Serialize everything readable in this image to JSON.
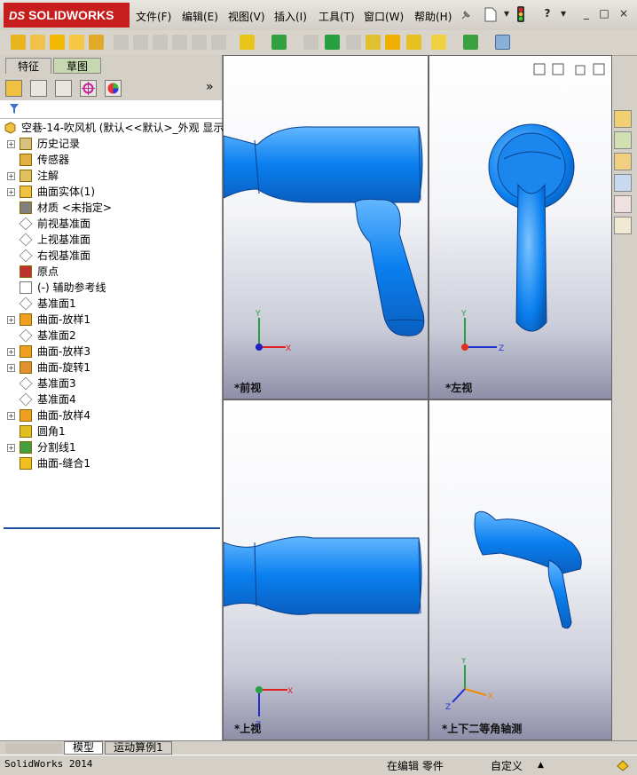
{
  "app": {
    "brand": "SOLIDWORKS",
    "brand_prefix": "DS"
  },
  "menus": [
    "文件(F)",
    "编辑(E)",
    "视图(V)",
    "插入(I)",
    "工具(T)",
    "窗口(W)",
    "帮助(H)"
  ],
  "window_controls": {
    "help": "?",
    "minimize": "_",
    "restore": "□",
    "close": "×"
  },
  "panel_tabs": [
    "特征",
    "草图"
  ],
  "panel_expand": "»",
  "tree": {
    "root": "空巷-14-吹风机   (默认<<默认>_外观 显示",
    "items": [
      {
        "label": "历史记录",
        "icon": "history-icon",
        "expandable": true
      },
      {
        "label": "传感器",
        "icon": "sensor-icon",
        "expandable": false
      },
      {
        "label": "注解",
        "icon": "annotation-icon",
        "expandable": true
      },
      {
        "label": "曲面实体(1)",
        "icon": "surface-body-icon",
        "expandable": true
      },
      {
        "label": "材质 <未指定>",
        "icon": "material-icon",
        "expandable": false
      },
      {
        "label": "前视基准面",
        "icon": "plane-icon",
        "expandable": false
      },
      {
        "label": "上视基准面",
        "icon": "plane-icon",
        "expandable": false
      },
      {
        "label": "右视基准面",
        "icon": "plane-icon",
        "expandable": false
      },
      {
        "label": "原点",
        "icon": "origin-icon",
        "expandable": false
      },
      {
        "label": "(-) 辅助参考线",
        "icon": "sketch-icon",
        "expandable": false
      },
      {
        "label": "基准面1",
        "icon": "plane-icon",
        "expandable": false
      },
      {
        "label": "曲面-放样1",
        "icon": "loft-icon",
        "expandable": true
      },
      {
        "label": "基准面2",
        "icon": "plane-icon",
        "expandable": false
      },
      {
        "label": "曲面-放样3",
        "icon": "loft-icon",
        "expandable": true
      },
      {
        "label": "曲面-旋转1",
        "icon": "revolve-icon",
        "expandable": true
      },
      {
        "label": "基准面3",
        "icon": "plane-icon",
        "expandable": false
      },
      {
        "label": "基准面4",
        "icon": "plane-icon",
        "expandable": false
      },
      {
        "label": "曲面-放样4",
        "icon": "loft-icon",
        "expandable": true
      },
      {
        "label": "圆角1",
        "icon": "fillet-icon",
        "expandable": false
      },
      {
        "label": "分割线1",
        "icon": "split-line-icon",
        "expandable": true
      },
      {
        "label": "曲面-缝合1",
        "icon": "knit-icon",
        "expandable": false
      }
    ]
  },
  "viewports": {
    "front": "*前视",
    "left": "*左视",
    "top": "*上视",
    "iso": "*上下二等角轴测"
  },
  "axis": {
    "x": "X",
    "y": "Y",
    "z": "Z"
  },
  "bottom_tabs": [
    "模型",
    "运动算例1"
  ],
  "status": {
    "app": "SolidWorks 2014",
    "mode": "在编辑 零件",
    "units": "自定义",
    "units_arrow": "▲"
  },
  "colors": {
    "model_blue": "#1e90ff",
    "brand_red": "#c71d1d",
    "tree_accent": "#1f4e9c"
  }
}
